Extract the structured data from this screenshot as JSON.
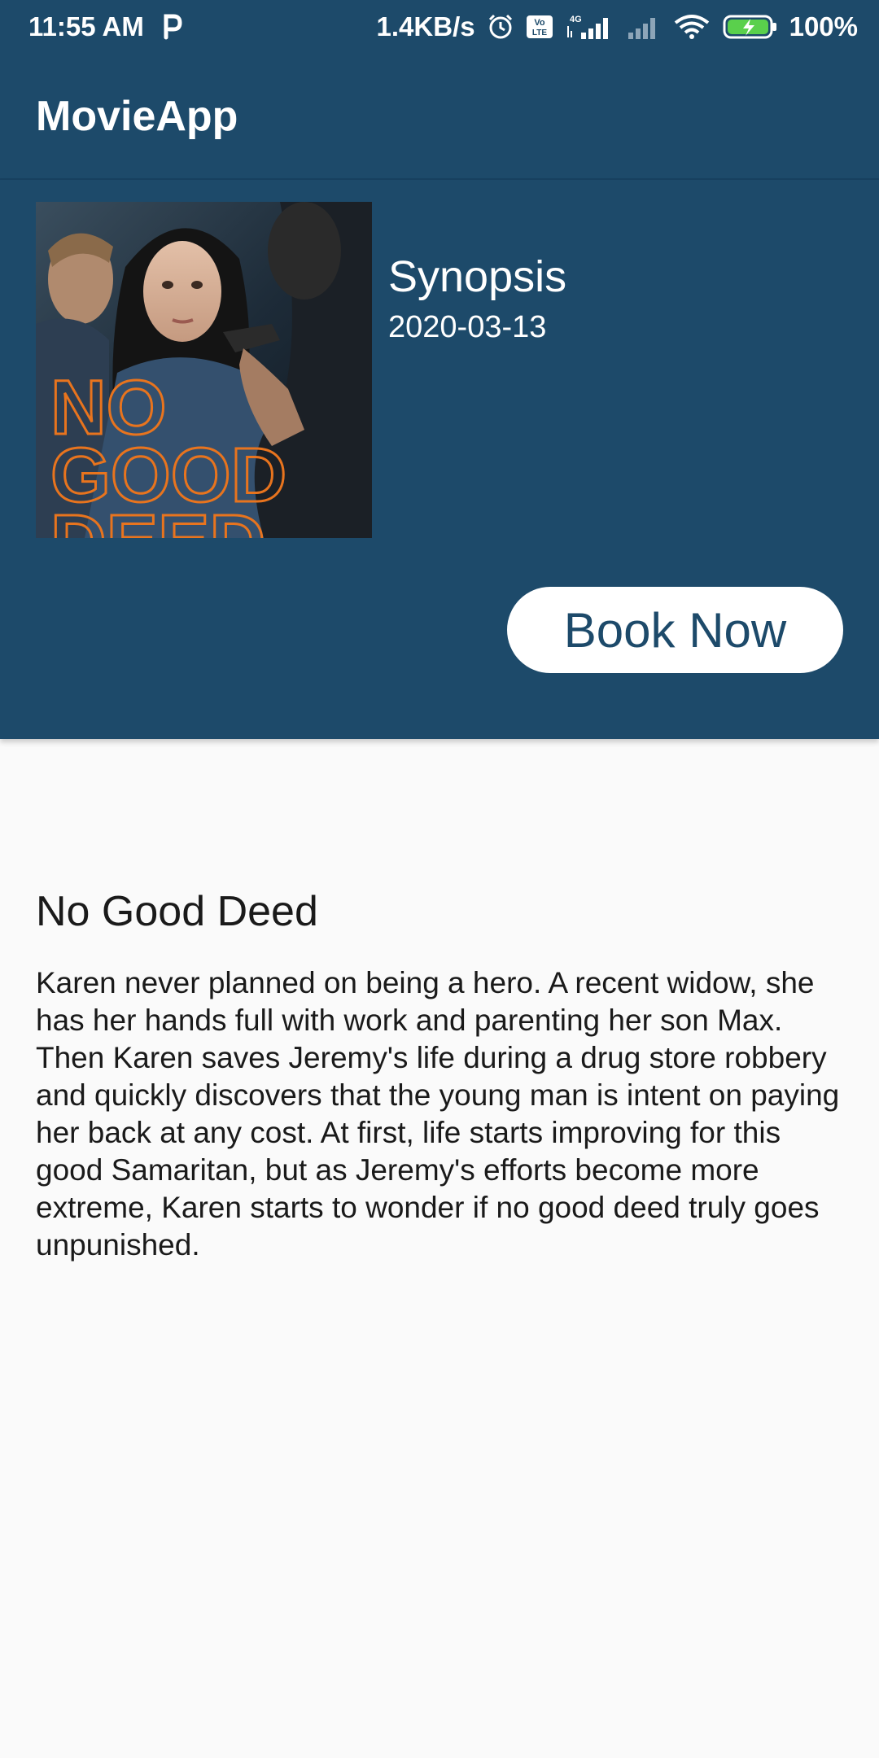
{
  "status_bar": {
    "time": "11:55 AM",
    "network_speed": "1.4KB/s",
    "network_type": "4G",
    "battery": "100%",
    "icons": [
      "p-icon",
      "alarm-icon",
      "volte-icon",
      "signal-icon",
      "signal-icon",
      "wifi-icon",
      "battery-charging-icon"
    ]
  },
  "app_bar": {
    "title": "MovieApp"
  },
  "header": {
    "synopsis_label": "Synopsis",
    "release_date": "2020-03-13",
    "poster_text": [
      "NO",
      "GOOD",
      "DEED"
    ],
    "book_button": "Book Now"
  },
  "movie": {
    "title": "No Good Deed",
    "overview": "Karen never planned on being a hero. A recent widow, she has her hands full with work and parenting her son Max. Then Karen saves Jeremy's life during a drug store robbery and quickly discovers that the young man is intent on paying her back at any cost. At first, life starts improving for this good Samaritan, but as Jeremy's efforts become more extreme, Karen starts to wonder if no good deed truly goes unpunished."
  },
  "colors": {
    "primary": "#1d4a6a",
    "background": "#fafafa",
    "button_bg": "#ffffff",
    "battery_green": "#5ad04c",
    "poster_text": "#e8741e"
  }
}
